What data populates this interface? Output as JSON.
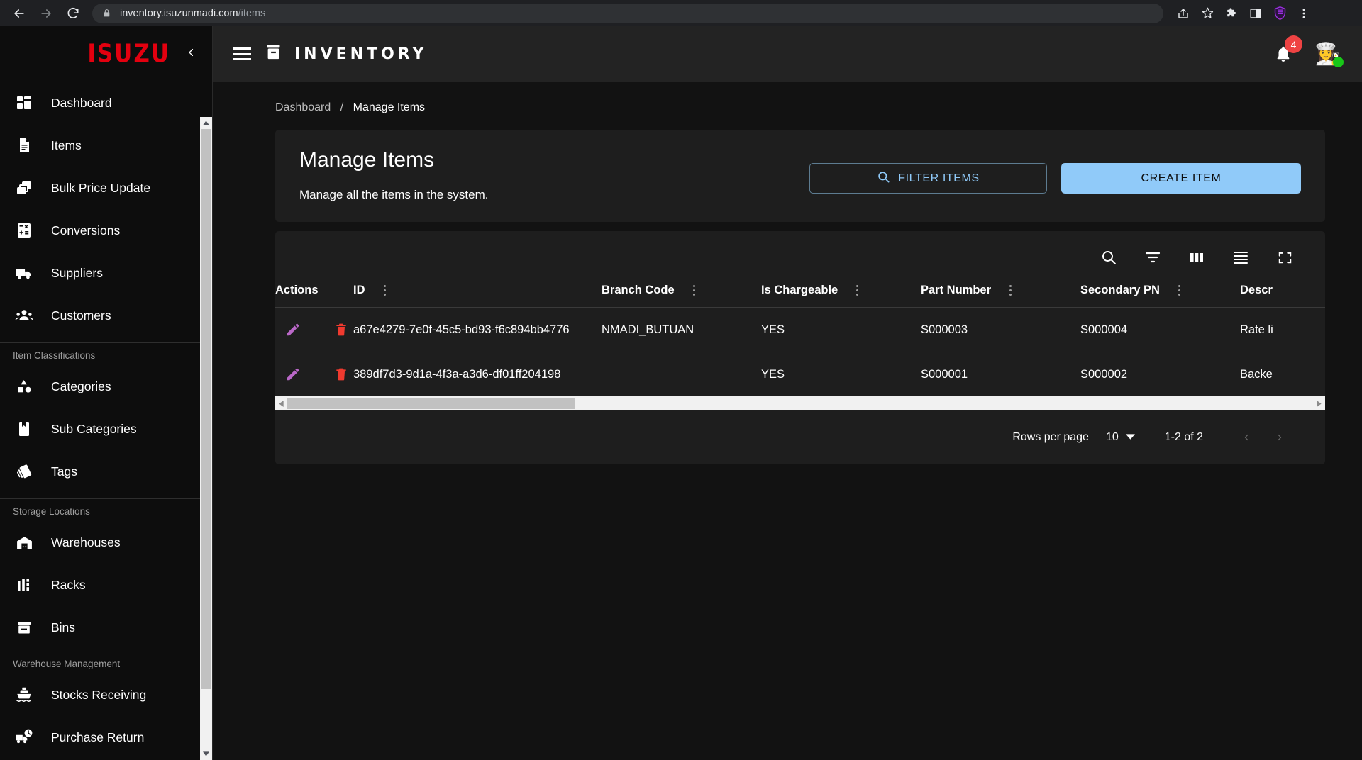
{
  "browser": {
    "back_icon": "arrow-left-icon",
    "forward_icon": "arrow-right-icon",
    "reload_icon": "reload-icon",
    "lock_icon": "lock-icon",
    "url_domain": "inventory.isuzunmadi.com",
    "url_path": "/items",
    "actions": [
      {
        "name": "share-icon",
        "glyph": "share"
      },
      {
        "name": "bookmark-star-icon",
        "glyph": "star"
      },
      {
        "name": "extensions-puzzle-icon",
        "glyph": "puzzle"
      },
      {
        "name": "side-panel-icon",
        "glyph": "panel"
      },
      {
        "name": "shield-extension-icon",
        "glyph": "shield"
      },
      {
        "name": "browser-menu-icon",
        "glyph": "kebab"
      }
    ]
  },
  "sidebar": {
    "brand": "ISUZU",
    "brand_color": "#e3000f",
    "collapse_icon": "chevron-left-icon",
    "items": [
      {
        "label": "Dashboard",
        "icon": "dashboard-icon"
      },
      {
        "label": "Items",
        "icon": "document-icon"
      },
      {
        "label": "Bulk Price Update",
        "icon": "copy-stack-icon"
      },
      {
        "label": "Conversions",
        "icon": "calculator-icon"
      },
      {
        "label": "Suppliers",
        "icon": "truck-icon"
      },
      {
        "label": "Customers",
        "icon": "people-icon"
      }
    ],
    "groups": [
      {
        "title": "Item Classifications",
        "items": [
          {
            "label": "Categories",
            "icon": "shapes-icon"
          },
          {
            "label": "Sub Categories",
            "icon": "bookmark-book-icon"
          },
          {
            "label": "Tags",
            "icon": "tags-icon"
          }
        ]
      },
      {
        "title": "Storage Locations",
        "items": [
          {
            "label": "Warehouses",
            "icon": "warehouse-icon"
          },
          {
            "label": "Racks",
            "icon": "racks-icon"
          },
          {
            "label": "Bins",
            "icon": "bin-box-icon"
          }
        ]
      },
      {
        "title": "Warehouse Management",
        "items": [
          {
            "label": "Stocks Receiving",
            "icon": "ship-icon"
          },
          {
            "label": "Purchase Return",
            "icon": "truck-clock-icon"
          }
        ]
      }
    ]
  },
  "topbar": {
    "menu_icon": "hamburger-menu-icon",
    "app_icon": "inventory-box-icon",
    "title": "INVENTORY",
    "bell_icon": "notification-bell-icon",
    "notification_count": "4",
    "avatar_icon": "user-avatar",
    "status_color": "#18c718"
  },
  "breadcrumb": {
    "parent": "Dashboard",
    "separator": "/",
    "current": "Manage Items"
  },
  "header": {
    "title": "Manage Items",
    "subtitle": "Manage all the items in the system.",
    "filter_button": "FILTER ITEMS",
    "filter_icon": "search-icon",
    "create_button": "CREATE ITEM",
    "accent_color": "#90caf9"
  },
  "table_toolbar": [
    {
      "name": "table-search-icon"
    },
    {
      "name": "table-filter-icon"
    },
    {
      "name": "table-columns-icon"
    },
    {
      "name": "table-density-icon"
    },
    {
      "name": "table-fullscreen-icon"
    }
  ],
  "table": {
    "columns": [
      "Actions",
      "ID",
      "Branch Code",
      "Is Chargeable",
      "Part Number",
      "Secondary PN",
      "Descr"
    ],
    "rows": [
      {
        "edit_icon": "edit-pencil-icon",
        "delete_icon": "delete-trash-icon",
        "id": "a67e4279-7e0f-45c5-bd93-f6c894bb4776",
        "branch_code": "NMADI_BUTUAN",
        "is_chargeable": "YES",
        "part_number": "S000003",
        "secondary_pn": "S000004",
        "description": "Rate li"
      },
      {
        "edit_icon": "edit-pencil-icon",
        "delete_icon": "delete-trash-icon",
        "id": "389df7d3-9d1a-4f3a-a3d6-df01ff204198",
        "branch_code": "",
        "is_chargeable": "YES",
        "part_number": "S000001",
        "secondary_pn": "S000002",
        "description": "Backe"
      }
    ]
  },
  "pagination": {
    "rows_per_page_label": "Rows per page",
    "rows_per_page_value": "10",
    "dropdown_icon": "chevron-down-icon",
    "range": "1-2 of 2",
    "prev_icon": "chevron-left-icon",
    "next_icon": "chevron-right-icon"
  }
}
